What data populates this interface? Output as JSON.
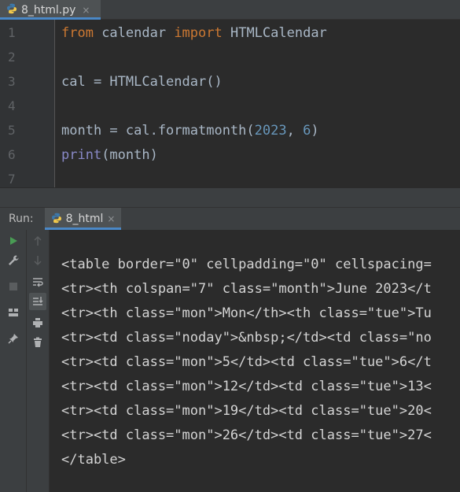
{
  "editor_tab": {
    "title": "8_html.py",
    "close": "×"
  },
  "editor": {
    "lines": [
      {
        "num": "1",
        "code": [
          {
            "t": "from",
            "c": "kw"
          },
          {
            "t": " calendar ",
            "c": ""
          },
          {
            "t": "import",
            "c": "kw"
          },
          {
            "t": " HTMLCalendar",
            "c": ""
          }
        ]
      },
      {
        "num": "2",
        "code": []
      },
      {
        "num": "3",
        "code": [
          {
            "t": "cal = HTMLCalendar()",
            "c": ""
          }
        ]
      },
      {
        "num": "4",
        "code": []
      },
      {
        "num": "5",
        "code": [
          {
            "t": "month = cal.formatmonth(",
            "c": ""
          },
          {
            "t": "2023",
            "c": "num"
          },
          {
            "t": ", ",
            "c": ""
          },
          {
            "t": "6",
            "c": "num"
          },
          {
            "t": ")",
            "c": ""
          }
        ]
      },
      {
        "num": "6",
        "code": [
          {
            "t": "print",
            "c": "bi"
          },
          {
            "t": "(month)",
            "c": ""
          }
        ]
      },
      {
        "num": "7",
        "code": []
      }
    ]
  },
  "run": {
    "label": "Run:",
    "tab_title": "8_html",
    "tab_close": "×",
    "toolbar_left": [
      "run-icon",
      "wrench-icon",
      "stop-icon",
      "layout-icon",
      "pin-icon"
    ],
    "toolbar_right": [
      "up-arrow-icon",
      "down-arrow-icon",
      "soft-wrap-icon",
      "scroll-to-end-icon",
      "print-icon",
      "trash-icon"
    ]
  },
  "console": {
    "lines": [
      "<table border=\"0\" cellpadding=\"0\" cellspacing=",
      "<tr><th colspan=\"7\" class=\"month\">June 2023</t",
      "<tr><th class=\"mon\">Mon</th><th class=\"tue\">Tu",
      "<tr><td class=\"noday\">&nbsp;</td><td class=\"no",
      "<tr><td class=\"mon\">5</td><td class=\"tue\">6</t",
      "<tr><td class=\"mon\">12</td><td class=\"tue\">13<",
      "<tr><td class=\"mon\">19</td><td class=\"tue\">20<",
      "<tr><td class=\"mon\">26</td><td class=\"tue\">27<",
      "</table>"
    ]
  },
  "colors": {
    "keyword": "#cc7832",
    "number": "#6897bb",
    "builtin": "#8888c6",
    "text": "#a9b7c6",
    "accent": "#4a88c7"
  }
}
